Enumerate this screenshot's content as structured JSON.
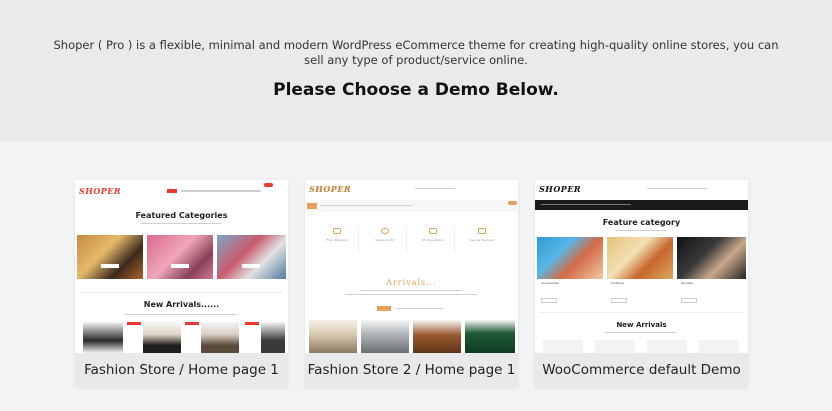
{
  "intro": {
    "text": "Shoper ( Pro ) is a flexible, minimal and modern WordPress eCommerce theme for creating high-quality online stores, you can sell any type of product/service online.",
    "heading": "Please Choose a Demo Below."
  },
  "colors": {
    "hero_bg": "#e9eaeb",
    "page_bg": "#f2f3f4",
    "card_label_bg": "#e8e9ea",
    "fashion_accent": "#e8382f",
    "fashion2_accent": "#e3a25a",
    "woo_dark": "#1a1a1a"
  },
  "demos": [
    {
      "label": "Fashion Store / Home page 1",
      "preview": {
        "logo": "SHOPER",
        "section_title": "Featured Categories",
        "new_title": "New Arrivals......"
      }
    },
    {
      "label": "Fashion Store 2 / Home page 1",
      "preview": {
        "logo": "SHOPER",
        "section_title": "Arrivals...",
        "features": [
          "Free Shipping",
          "Support 24/7",
          "30 Days Return",
          "Secure Payment"
        ]
      }
    },
    {
      "label": "WooCommerce default Demo",
      "preview": {
        "logo": "SHOPER",
        "section_title": "Feature category",
        "new_title": "New Arrivals",
        "categories": [
          "Accessories",
          "Clothing",
          "Hoodies"
        ]
      }
    }
  ]
}
